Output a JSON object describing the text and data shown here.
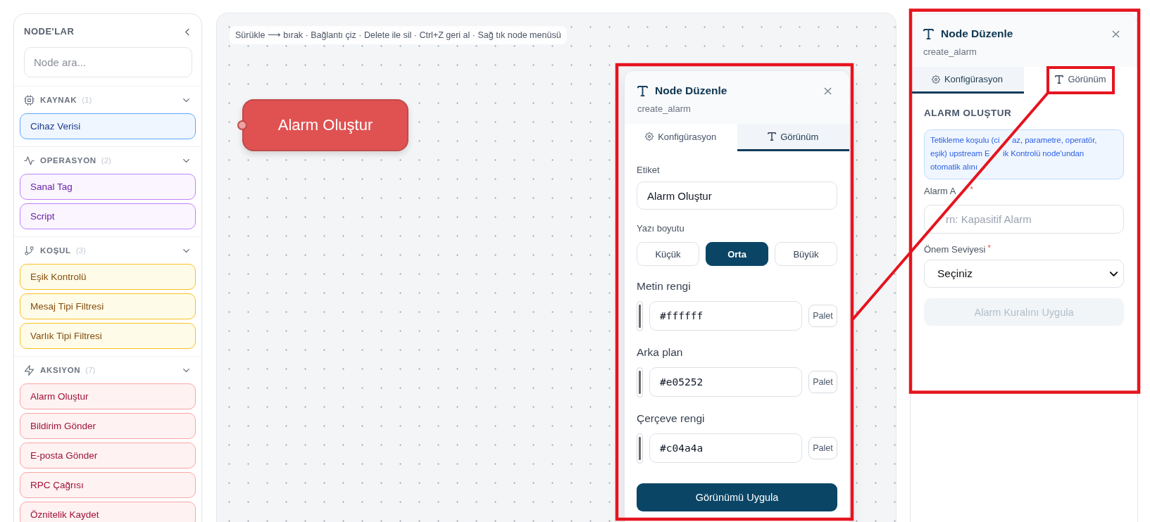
{
  "sidebar": {
    "title": "NODE'LAR",
    "search": {
      "placeholder": "Node ara..."
    },
    "groups": [
      {
        "kind": "source",
        "label": "KAYNAK",
        "count": "(1)",
        "expanded": true,
        "items": [
          "Cihaz Verisi"
        ]
      },
      {
        "kind": "operation",
        "label": "OPERASYON",
        "count": "(2)",
        "expanded": true,
        "items": [
          "Sanal Tag",
          "Script"
        ]
      },
      {
        "kind": "condition",
        "label": "KOŞUL",
        "count": "(3)",
        "expanded": true,
        "items": [
          "Eşik Kontrolü",
          "Mesaj Tipi Filtresi",
          "Varlık Tipi Filtresi"
        ]
      },
      {
        "kind": "action",
        "label": "AKSIYON",
        "count": "(7)",
        "expanded": true,
        "items": [
          "Alarm Oluştur",
          "Bildirim Gönder",
          "E-posta Gönder",
          "RPC Çağrısı",
          "Öznitelik Kaydet"
        ]
      }
    ]
  },
  "canvas": {
    "hint": "Sürükle ⟶ bırak · Bağlantı çiz · Delete ile sil · Ctrl+Z geri al · Sağ tık node menüsü",
    "nodes": [
      {
        "kind": "action",
        "label": "Alarm Oluştur"
      }
    ]
  },
  "editor": {
    "title": "Node Düzenle",
    "subtitle": "create_alarm",
    "tabs": [
      {
        "kind": "config",
        "label": "Konfigürasyon",
        "selected": false
      },
      {
        "kind": "appearance",
        "label": "Görünüm",
        "selected": true
      }
    ],
    "label_field": {
      "label": "Etiket",
      "value": "Alarm Oluştur"
    },
    "font_size": {
      "label": "Yazı boyutu",
      "options": [
        {
          "label": "Küçük",
          "selected": false
        },
        {
          "label": "Orta",
          "selected": true
        },
        {
          "label": "Büyük",
          "selected": false
        }
      ]
    },
    "colors": [
      {
        "label": "Metin rengi",
        "value": "#ffffff",
        "button": "Palet"
      },
      {
        "label": "Arka plan",
        "value": "#e05252",
        "button": "Palet"
      },
      {
        "label": "Çerçeve rengi",
        "value": "#c04a4a",
        "button": "Palet"
      }
    ],
    "apply_button": "Görünümü Uygula"
  },
  "inspector": {
    "title": "Node Düzenle",
    "subtitle": "create_alarm",
    "tabs": [
      {
        "kind": "config",
        "label": "Konfigürasyon",
        "selected": true
      },
      {
        "kind": "appearance",
        "label": "Görünüm",
        "selected": false
      }
    ],
    "section_title": "ALARM OLUŞTUR",
    "info": [
      [
        "Tetikleme koşulu (ci",
        "az, parametre, operatör,"
      ],
      [
        "eşik) upstream E",
        "ik Kontrolü node'undan"
      ],
      [
        "otomatik alını"
      ]
    ],
    "fields": [
      {
        "kind": "text",
        "label": "Alarm A",
        "required_mark": "*",
        "placeholder": "rn: Kapasitif Alarm"
      },
      {
        "kind": "select",
        "label": "Önem Seviyesi",
        "required_mark": "*",
        "value": "Seçiniz"
      }
    ],
    "apply_button": {
      "label": "Alarm Kuralını Uygula",
      "disabled": true
    }
  }
}
